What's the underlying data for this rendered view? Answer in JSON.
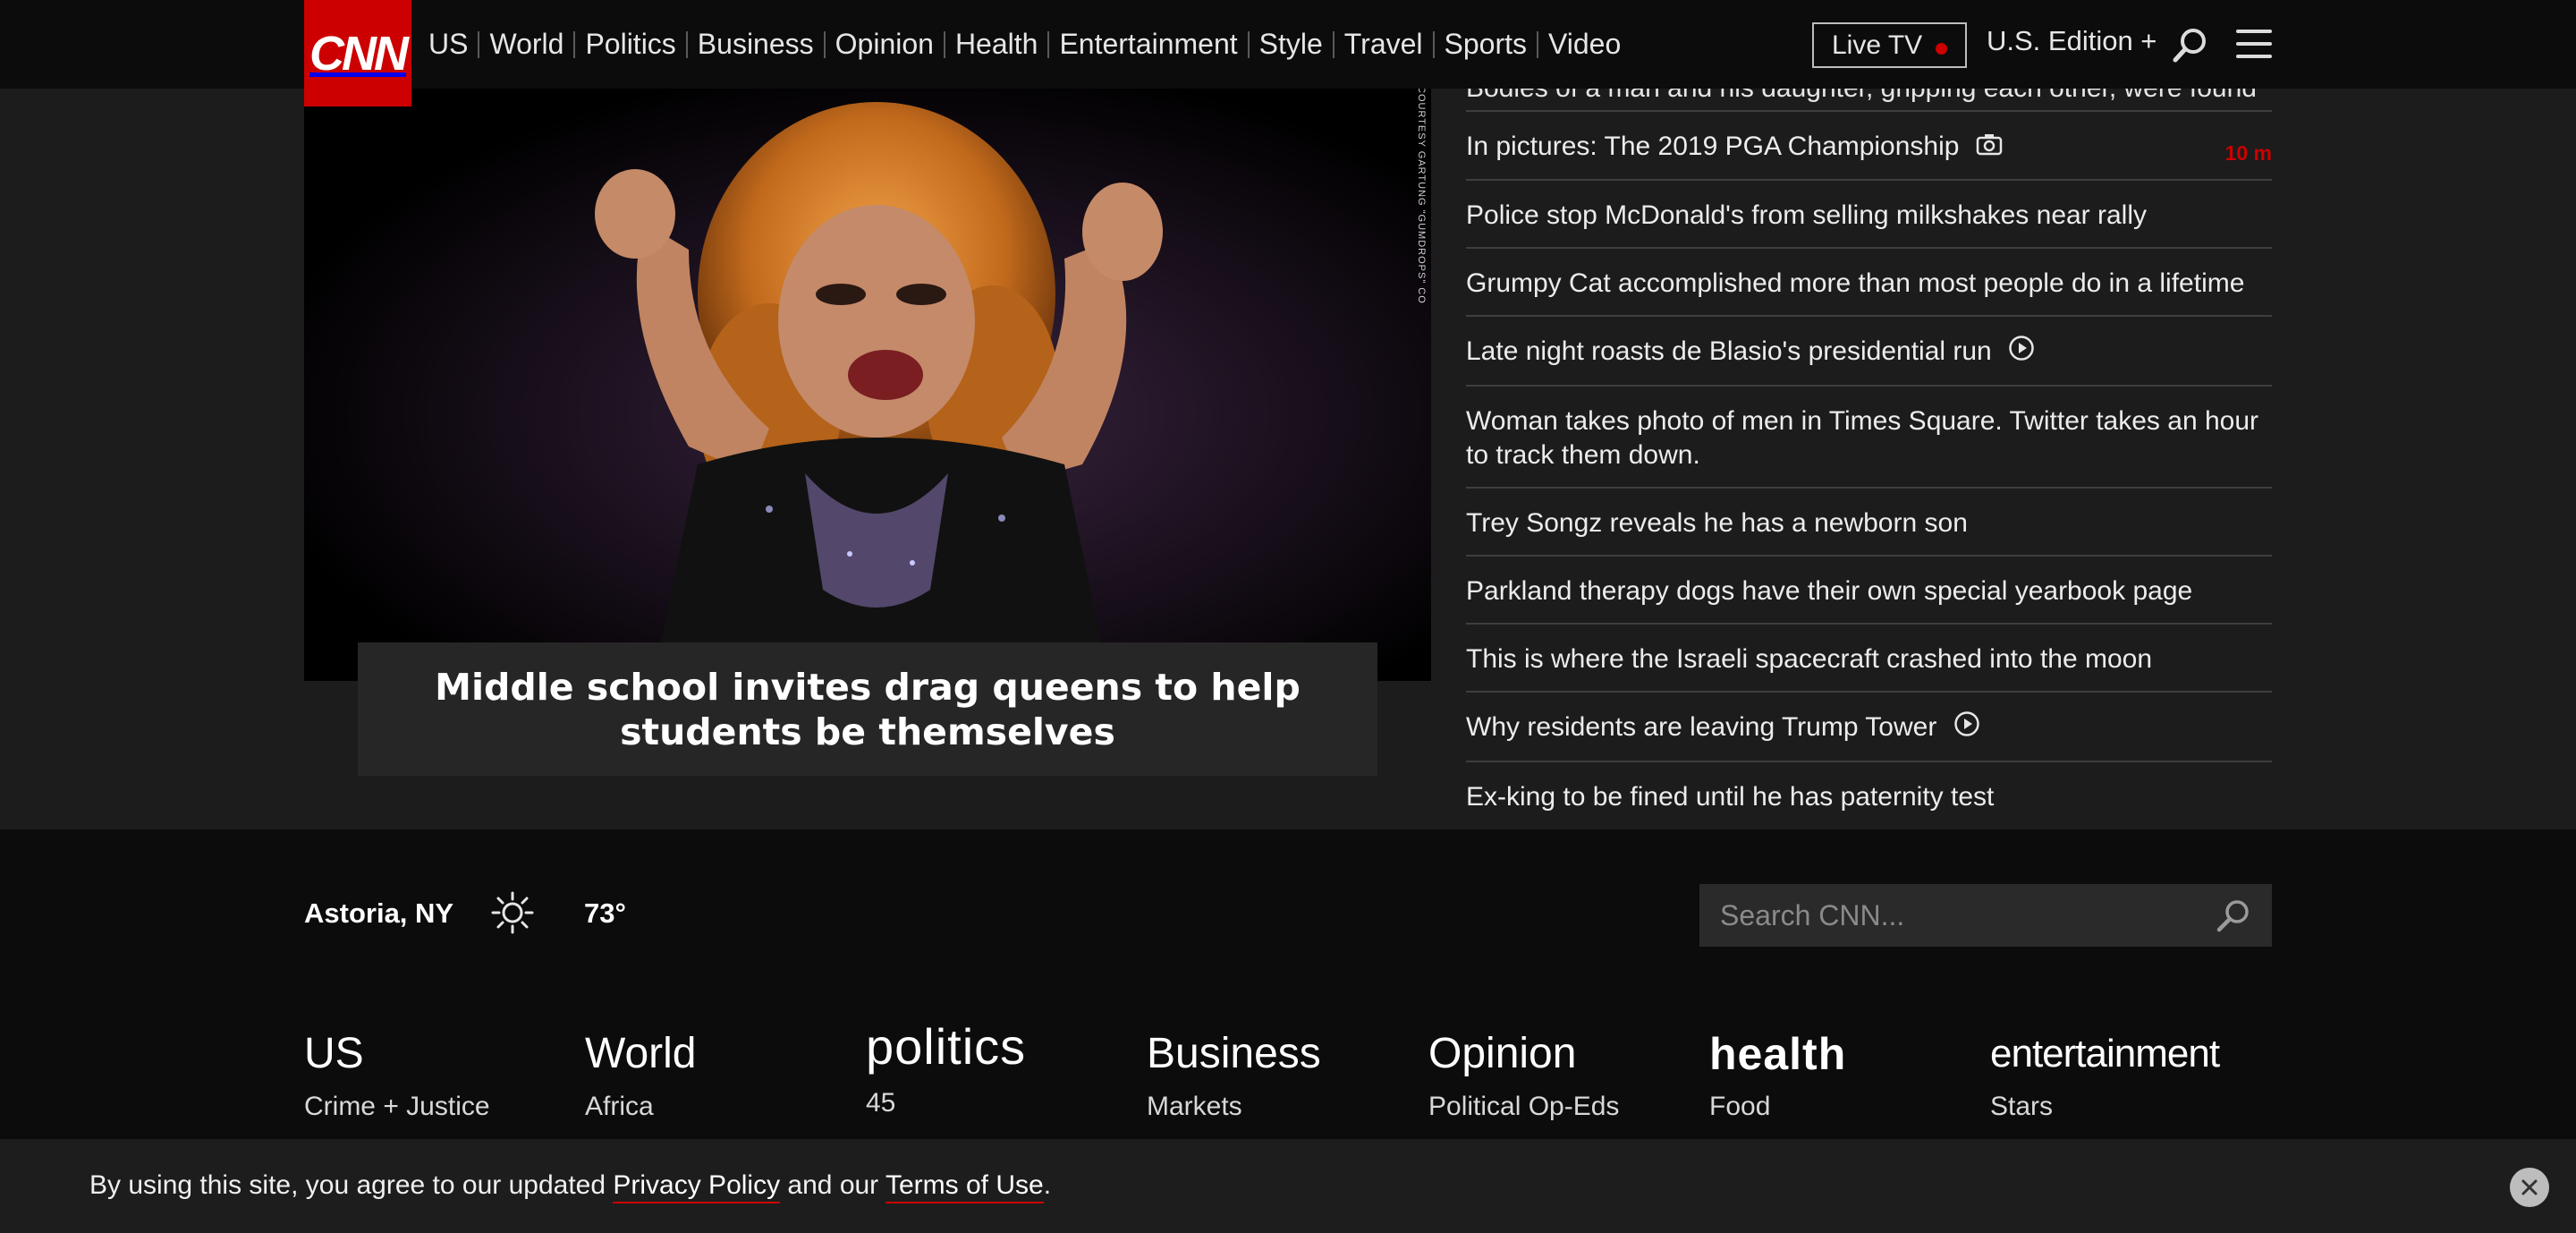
{
  "brand": {
    "logo_text": "CNN"
  },
  "nav": {
    "links": [
      "US",
      "World",
      "Politics",
      "Business",
      "Opinion",
      "Health",
      "Entertainment",
      "Style",
      "Travel",
      "Sports",
      "Video"
    ],
    "live_tv": "Live TV",
    "edition": "U.S. Edition +"
  },
  "hero": {
    "headline": "Middle school invites drag queens to help students be themselves",
    "photo_credit": "COURTESY GARTUNG \"GUMDROPS\" CO"
  },
  "headlines": {
    "partial_top": "Bodies of a man and his daughter, gripping each other, were found",
    "items": [
      {
        "text": "In pictures: The 2019 PGA Championship",
        "icon": "camera-icon",
        "time": "10 m"
      },
      {
        "text": "Police stop McDonald's from selling milkshakes near rally"
      },
      {
        "text": "Grumpy Cat accomplished more than most people do in a lifetime"
      },
      {
        "text": "Late night roasts de Blasio's presidential run",
        "icon": "play-icon"
      },
      {
        "text": "Woman takes photo of men in Times Square. Twitter takes an hour to track them down."
      },
      {
        "text": "Trey Songz reveals he has a newborn son"
      },
      {
        "text": "Parkland therapy dogs have their own special yearbook page"
      },
      {
        "text": "This is where the Israeli spacecraft crashed into the moon"
      },
      {
        "text": "Why residents are leaving Trump Tower",
        "icon": "play-icon"
      },
      {
        "text": "Ex-king to be fined until he has paternity test"
      }
    ]
  },
  "weather": {
    "location": "Astoria, NY",
    "temp": "73°",
    "icon": "sun-icon"
  },
  "search": {
    "placeholder": "Search CNN..."
  },
  "footer_sections": [
    {
      "title": "US",
      "sub": "Crime + Justice"
    },
    {
      "title": "World",
      "sub": "Africa"
    },
    {
      "title": "politics",
      "sub": "45"
    },
    {
      "title": "Business",
      "sub": "Markets"
    },
    {
      "title": "Opinion",
      "sub": "Political Op-Eds"
    },
    {
      "title": "health",
      "sub": "Food"
    },
    {
      "title": "entertainment",
      "sub": "Stars"
    }
  ],
  "cookie": {
    "prefix": "By using this site, you agree to our updated ",
    "privacy_link": "Privacy Policy",
    "middle": " and our ",
    "terms_link": "Terms of Use",
    "suffix": "."
  },
  "colors": {
    "accent": "#cc0000",
    "background": "#0c0c0c",
    "panel": "#1c1c1c"
  }
}
